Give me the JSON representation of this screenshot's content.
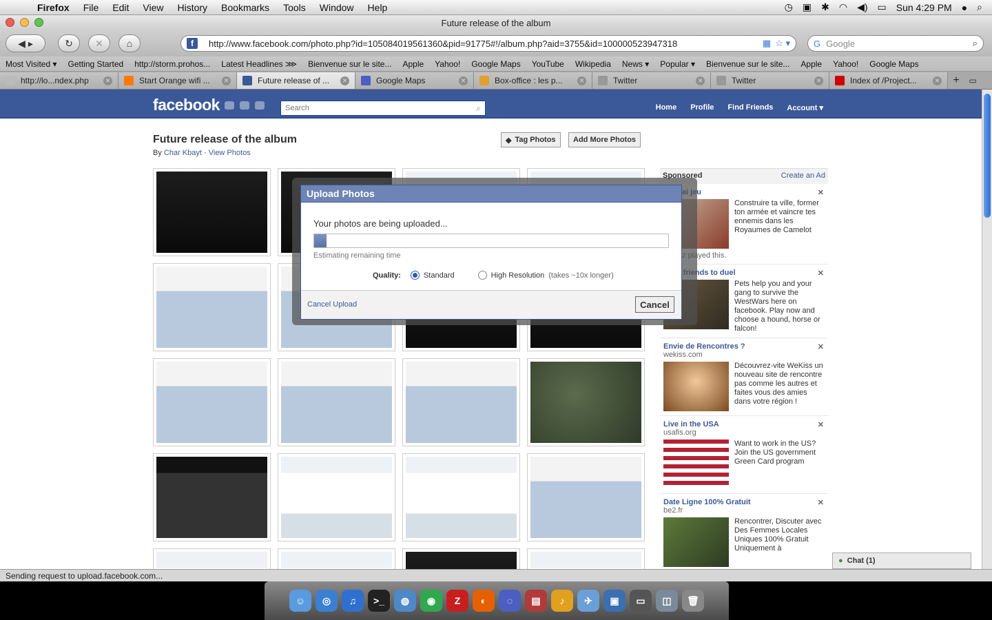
{
  "menubar": {
    "app": "Firefox",
    "items": [
      "File",
      "Edit",
      "View",
      "History",
      "Bookmarks",
      "Tools",
      "Window",
      "Help"
    ],
    "clock": "Sun 4:29 PM"
  },
  "window": {
    "title": "Future release of the album"
  },
  "urlbar": {
    "url": "http://www.facebook.com/photo.php?id=105084019561360&pid=91775#!/album.php?aid=3755&id=100000523947318"
  },
  "searchbar": {
    "placeholder": "Google"
  },
  "bookmarks": [
    "Most Visited ▾",
    "Getting Started",
    "http://storm.prohos...",
    "Latest Headlines ⋙",
    "Bienvenue sur le site...",
    "Apple",
    "Yahoo!",
    "Google Maps",
    "YouTube",
    "Wikipedia",
    "News ▾",
    "Popular ▾",
    "Bienvenue sur le site...",
    "Apple",
    "Yahoo!",
    "Google Maps"
  ],
  "tabs": [
    {
      "label": "http://lo...ndex.php",
      "color": "#bbbbbb"
    },
    {
      "label": "Start Orange wifi ...",
      "color": "#ff7900"
    },
    {
      "label": "Future release of ...",
      "color": "#3b5998"
    },
    {
      "label": "Google Maps",
      "color": "#4a5fc1"
    },
    {
      "label": "Box-office : les p...",
      "color": "#e0a030"
    },
    {
      "label": "Twitter",
      "color": "#999999"
    },
    {
      "label": "Twitter",
      "color": "#999999"
    },
    {
      "label": "Index of /Project...",
      "color": "#cc0000"
    }
  ],
  "facebook": {
    "logo": "facebook",
    "search_placeholder": "Search",
    "nav": [
      "Home",
      "Profile",
      "Find Friends",
      "Account ▾"
    ]
  },
  "album": {
    "title": "Future release of the album",
    "by_prefix": "By",
    "author": "Char Kbayt",
    "separator": "·",
    "view_photos": "View Photos",
    "tag_button": "Tag Photos",
    "add_button": "Add More Photos"
  },
  "sponsored": {
    "heading": "Sponsored",
    "create_ad": "Create an Ad",
    "ads": [
      {
        "title": "un vrai jeu",
        "domain": "",
        "text": "Construire ta ville, former ton armée et vaincre tes ennemis dans les Royaumes de Camelot",
        "social": "Yilmaz played this."
      },
      {
        "title": "enge friends to duel",
        "domain": "",
        "text": "Pets help you and your gang to survive the WestWars here on facebook. Play now and choose a hound, horse or falcon!",
        "social": ""
      },
      {
        "title": "Envie de Rencontres ?",
        "domain": "wekiss.com",
        "text": "Découvrez-vite WeKiss un nouveau site de rencontre pas comme les autres et faites vous des amies dans votre région !",
        "social": ""
      },
      {
        "title": "Live in the USA",
        "domain": "usafis.org",
        "text": "Want to work in the US? Join the US government Green Card program",
        "social": ""
      },
      {
        "title": "Date Ligne 100% Gratuit",
        "domain": "be2.fr",
        "text": "Rencontrer, Discuter avec Des Femmes Locales Uniques 100% Gratuit Uniquement à",
        "social": ""
      }
    ]
  },
  "chat": {
    "label": "Chat (1)"
  },
  "dialog": {
    "title": "Upload Photos",
    "message": "Your photos are being uploaded...",
    "progress": 0.035,
    "eta": "Estimating remaining time",
    "quality_label": "Quality:",
    "standard": "Standard",
    "high_res": "High Resolution",
    "high_res_note": "(takes ~10x longer)",
    "cancel_link": "Cancel Upload",
    "cancel_button": "Cancel"
  },
  "statusbar": {
    "text": "Sending request to upload.facebook.com..."
  }
}
